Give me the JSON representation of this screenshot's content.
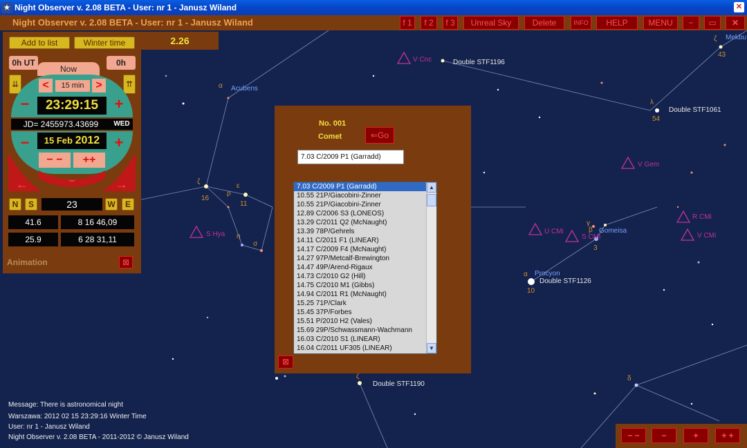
{
  "window": {
    "title": "Night Observer v. 2.08 BETA -  User:  nr 1 - Janusz Wiland"
  },
  "toolbar": {
    "app_title": "Night Observer v. 2.08 BETA -  User:  nr 1 - Janusz Wiland",
    "buttons": [
      "f 1",
      "f 2",
      "f 3",
      "Unreal Sky",
      "Delete",
      "INFO",
      "HELP",
      "MENU"
    ]
  },
  "panel": {
    "add_to_list": "Add to list",
    "winter_time": "Winter time",
    "ut": "0h UT",
    "now": "Now",
    "h": "0h",
    "step": "15 min",
    "time": "23:29:15",
    "jd": "JD= 2455973.43699",
    "weekday": "WED",
    "date_day": "15 Feb",
    "date_year": "2012",
    "minus_minus": "− −",
    "plus_plus": "++",
    "n": "N",
    "s": "S",
    "w": "W",
    "e": "E",
    "azimuth": "23",
    "val1": "41.6",
    "coord1": "8 16 46,09",
    "val2": "25.9",
    "coord2": "6 28 31,11",
    "animation": "Animation"
  },
  "magnitude": "2.26",
  "dialog": {
    "number": "No.  001",
    "type": "Comet",
    "go": "Go",
    "selected": "7.03  C/2009 P1 (Garradd)",
    "comets": [
      "7.03  C/2009 P1 (Garradd)",
      "10.55  21P/Giacobini-Zinner",
      "10.55  21P/Giacobini-Zinner",
      "12.89  C/2006 S3 (LONEOS)",
      "13.29  C/2011 Q2 (McNaught)",
      "13.39  78P/Gehrels",
      "14.11  C/2011 F1 (LINEAR)",
      "14.17  C/2009 F4 (McNaught)",
      "14.27  97P/Metcalf-Brewington",
      "14.47  49P/Arend-Rigaux",
      "14.73  C/2010 G2 (Hill)",
      "14.75  C/2010 M1 (Gibbs)",
      "14.94  C/2011 R1 (McNaught)",
      "15.25  71P/Clark",
      "15.45  37P/Forbes",
      "15.51  P/2010 H2 (Vales)",
      "15.69  29P/Schwassmann-Wachmann",
      "16.03  C/2010 S1 (LINEAR)",
      "16.04  C/2011 UF305 (LINEAR)"
    ]
  },
  "sky_labels": {
    "stf1196": "Double STF1196",
    "stf1061": "Double STF1061",
    "stf1126": "Double STF1126",
    "stf1190": "Double STF1190",
    "acubens": "Acubens",
    "procyon": "Procyon",
    "gomeisa": "Gomeisa",
    "mekbuda": "Mekbu",
    "vcnc": "V Cnc",
    "vgem": "V Gem",
    "shya": "S Hya",
    "ucmi": "U CMi",
    "scmi": "S CMi",
    "rcmi": "R CMi",
    "vcmi": "V CMi"
  },
  "status": {
    "message": "Message: There is astronomical night",
    "location": "Warszawa:  2012 02 15  23:29:16 Winter Time",
    "user": "User:  nr 1 - Janusz Wiland",
    "copyright": "Night Observer v. 2.08 BETA - 2011-2012 © Janusz Wiland"
  },
  "zoom": [
    "− −",
    "−",
    "+",
    "+ +"
  ]
}
